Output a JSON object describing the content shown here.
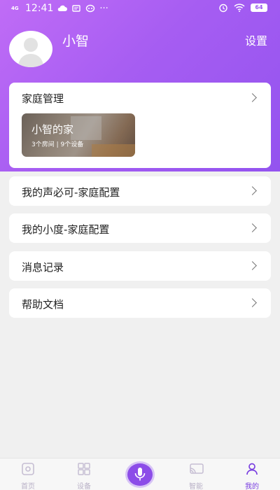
{
  "status_bar": {
    "network": "4G",
    "time": "12:41",
    "battery": "64"
  },
  "profile": {
    "username": "小智",
    "settings_label": "设置"
  },
  "home_card": {
    "title": "家庭管理",
    "home_name": "小智的家",
    "home_info": "3个房间 | 9个设备"
  },
  "menu": {
    "items": [
      {
        "label": "我的声必可-家庭配置"
      },
      {
        "label": "我的小度-家庭配置"
      },
      {
        "label": "消息记录"
      },
      {
        "label": "帮助文档"
      }
    ]
  },
  "bottom_nav": {
    "items": [
      {
        "label": "首页",
        "icon": "home-icon"
      },
      {
        "label": "设备",
        "icon": "grid-icon"
      },
      {
        "label": "",
        "icon": "microphone-icon"
      },
      {
        "label": "智能",
        "icon": "cast-icon"
      },
      {
        "label": "我的",
        "icon": "person-icon"
      }
    ],
    "active": "我的"
  },
  "colors": {
    "accent": "#9353ef",
    "header_gradient_start": "#c06cf6",
    "active_tab": "#7a3fe0"
  }
}
